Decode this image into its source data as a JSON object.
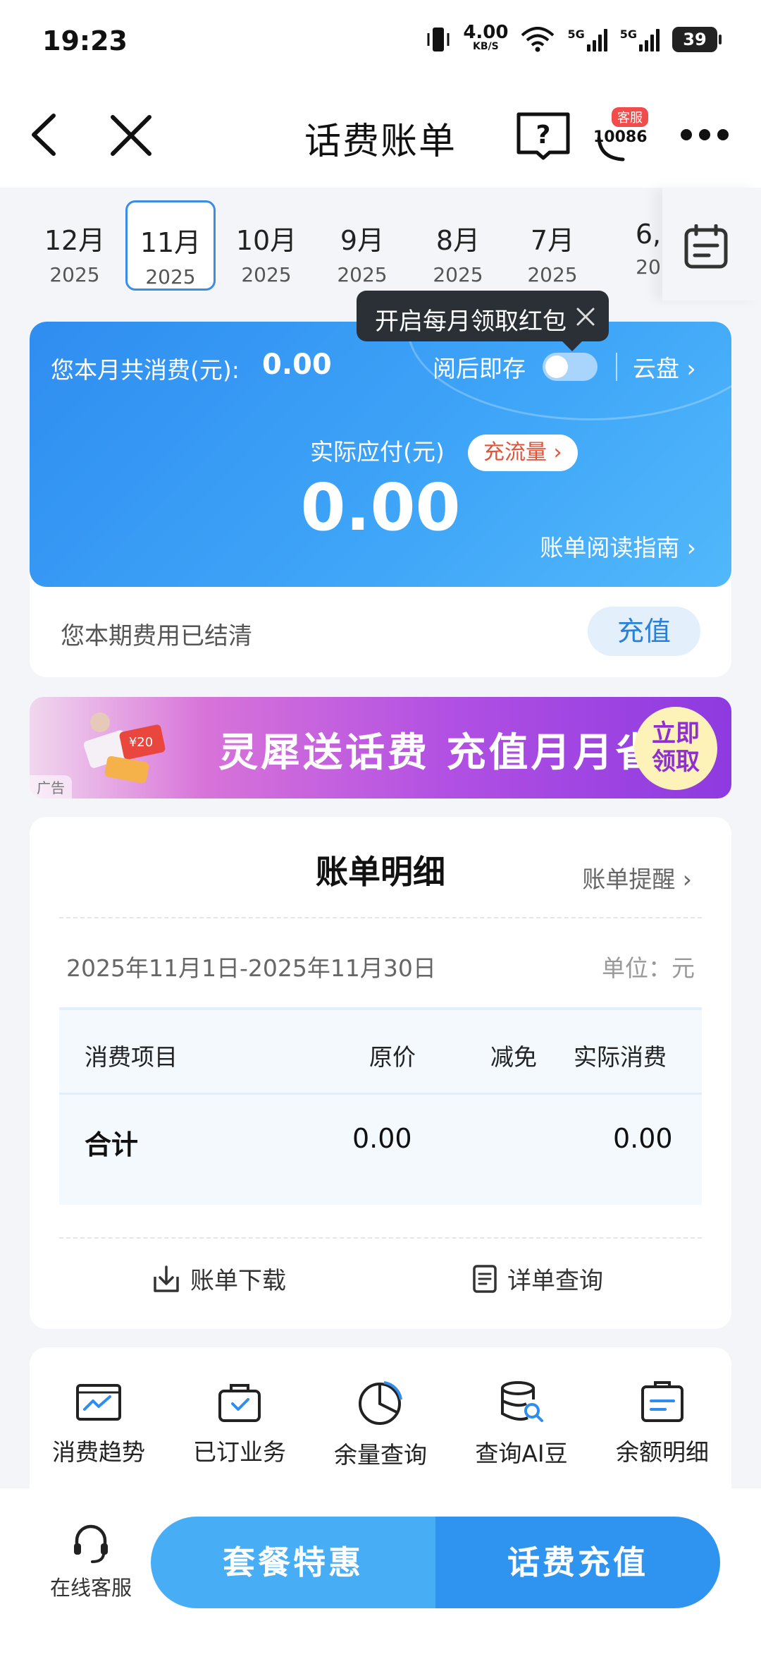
{
  "status_bar": {
    "time": "19:23",
    "net_speed": "4.00",
    "net_speed_unit": "KB/S",
    "signal_1": "5G",
    "signal_2": "5G",
    "battery": "39"
  },
  "nav": {
    "title": "话费账单",
    "kefu_badge": "客服",
    "kefu_number": "10086"
  },
  "months": [
    {
      "month": "12月",
      "year": "2025"
    },
    {
      "month": "11月",
      "year": "2025"
    },
    {
      "month": "10月",
      "year": "2025"
    },
    {
      "month": "9月",
      "year": "2025"
    },
    {
      "month": "8月",
      "year": "2025"
    },
    {
      "month": "7月",
      "year": "2025"
    },
    {
      "month": "6,",
      "year": "20"
    }
  ],
  "tooltip": {
    "text": "开启每月领取红包"
  },
  "bill": {
    "total_label": "您本月共消费(元):",
    "total_value": "0.00",
    "save_label": "阅后即存",
    "cloud_link": "云盘 ›",
    "actual_label": "实际应付(元)",
    "flow_button": "充流量 ›",
    "actual_value": "0.00",
    "guide_link": "账单阅读指南 ›",
    "settled_text": "您本期费用已结清",
    "recharge_button": "充值"
  },
  "ad": {
    "text": "灵犀送话费 充值月月省",
    "badge_line1": "立即",
    "badge_line2": "领取",
    "tag": "广告"
  },
  "detail": {
    "title": "账单明细",
    "reminder_link": "账单提醒 ›",
    "period": "2025年11月1日-2025年11月30日",
    "unit": "单位：元",
    "columns": [
      "消费项目",
      "原价",
      "减免",
      "实际消费"
    ],
    "total_row": {
      "item": "合计",
      "original": "0.00",
      "discount": "",
      "actual": "0.00"
    },
    "download": "账单下载",
    "query": "详单查询"
  },
  "services": [
    {
      "label": "消费趋势",
      "icon": "trend-icon"
    },
    {
      "label": "已订业务",
      "icon": "briefcase-icon"
    },
    {
      "label": "余量查询",
      "icon": "pie-icon"
    },
    {
      "label": "查询AI豆",
      "icon": "database-search-icon"
    },
    {
      "label": "余额明细",
      "icon": "clipboard-icon"
    }
  ],
  "bottom": {
    "customer_service": "在线客服",
    "package_button": "套餐特惠",
    "topup_button": "话费充值"
  },
  "colors": {
    "primary_blue": "#2f8df0",
    "accent_red": "#e0533a",
    "ad_purple": "#8d3ae0"
  }
}
